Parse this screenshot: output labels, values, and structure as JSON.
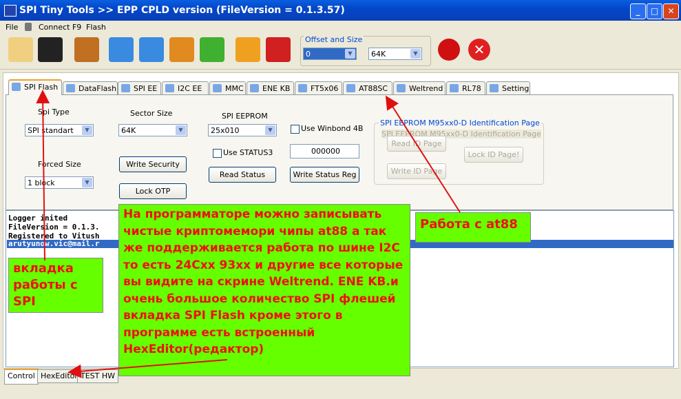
{
  "window": {
    "title": "SPI Tiny Tools >> EPP CPLD version (FileVersion = 0.1.3.57)",
    "minimize": "_",
    "maximize": "□",
    "close": "✕"
  },
  "menu": [
    "File",
    "Connect  F9",
    "Flash"
  ],
  "toolbar": {
    "icons": [
      "open-folder-icon",
      "save-icon",
      "battery-power-icon",
      "upload-icon",
      "download-icon",
      "swap-icon",
      "verify-icon",
      "flash-bolt-icon",
      "erase-icon",
      "stop-icon",
      "cancel-icon"
    ],
    "offset_group": "Offset and Size",
    "offset_value": "0",
    "size_value": "64K"
  },
  "tabs": [
    "SPI Flash",
    "DataFlash",
    "SPI EE",
    "I2C EE",
    "MMC",
    "ENE KB",
    "FT5x06",
    "AT88SC",
    "Weltrend",
    "RL78",
    "Setting"
  ],
  "spi": {
    "spi_type_label": "Spi Type",
    "spi_type_value": "SPI standart",
    "forced_size_label": "Forced Size",
    "forced_size_value": "1 block",
    "sector_size_label": "Sector Size",
    "sector_size_value": "64K",
    "write_security": "Write Security",
    "lock_otp": "Lock OTP",
    "eeprom_label": "SPI EEPROM",
    "eeprom_value": "25x010",
    "use_status3": "Use STATUS3",
    "read_status": "Read Status",
    "use_winbond": "Use Winbond 4B",
    "status_value": "000000",
    "write_status": "Write Status Reg",
    "id_group": "SPI EEPROM M95xx0-D Identification Page",
    "id_caption": "SPI EEPROM M95xx0-D Identification Page",
    "read_id": "Read ID Page",
    "write_id": "Write ID Page",
    "lock_id": "Lock ID Page!"
  },
  "log": [
    "Logger inited",
    "FileVersion = 0.1.3.",
    "Registered to Vitush",
    "arutyunow.vic@mail.r"
  ],
  "bottom_tabs": [
    "Control",
    "HexEditor",
    "TEST HW"
  ],
  "annotations": {
    "main": "На программаторе можно записывать чистые криптомемори чипы at88 а так же поддерживается работа по шине I2C то есть 24Cxx 93xx и другие все которые вы видите на скрине Weltrend. ENE KB.и очень большое количество SPI флешей вкладка SPI Flash кроме этого в программе есть встроенный HexEditor(редактор)",
    "spi": "вкладка работы с SPI",
    "at88": "Работа с at88"
  },
  "colors": {
    "annotation_bg": "#66ff00",
    "annotation_text": "#ee1111",
    "title_bar": "#0347c8",
    "selection": "#316ac5"
  }
}
